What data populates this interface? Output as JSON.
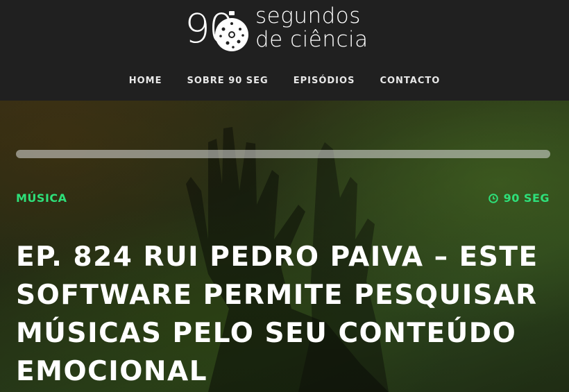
{
  "header": {
    "logo": {
      "number": "90",
      "line1": "segundos",
      "line2": "de ciência"
    },
    "nav": [
      {
        "label": "HOME"
      },
      {
        "label": "SOBRE 90 SEG"
      },
      {
        "label": "EPISÓDIOS"
      },
      {
        "label": "CONTACTO"
      }
    ]
  },
  "episode": {
    "category": "MÚSICA",
    "duration": "90 SEG",
    "title": "EP. 824 RUI PEDRO PAIVA – ESTE SOFTWARE PERMITE PESQUISAR MÚSICAS PELO SEU CONTEÚDO EMOCIONAL"
  },
  "colors": {
    "header_bg": "#202020",
    "accent": "#2ee07a",
    "text": "#ffffff"
  }
}
